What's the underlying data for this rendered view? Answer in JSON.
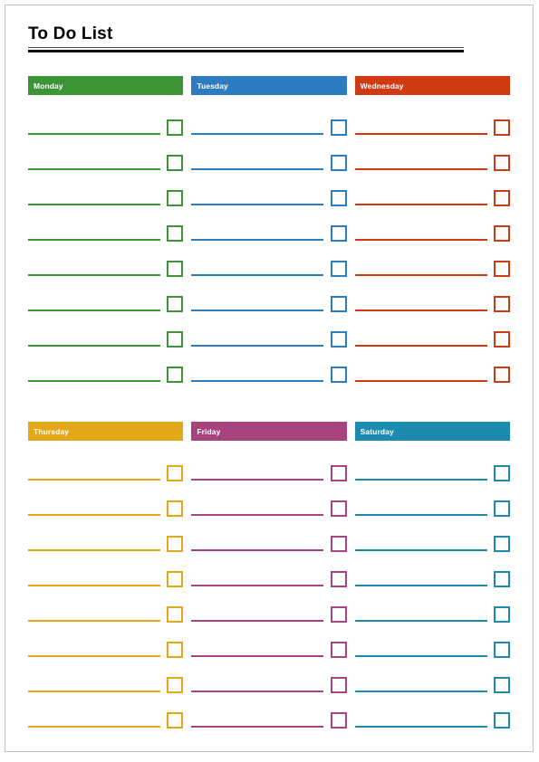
{
  "page": {
    "title": "To Do List",
    "border_color": "#bfbfbf",
    "background": "#ffffff"
  },
  "rows_per_day": 8,
  "days": [
    {
      "name": "Monday",
      "color": "#3D9435",
      "tasks": [
        "",
        "",
        "",
        "",
        "",
        "",
        "",
        ""
      ]
    },
    {
      "name": "Tuesday",
      "color": "#2E7CC0",
      "tasks": [
        "",
        "",
        "",
        "",
        "",
        "",
        "",
        ""
      ]
    },
    {
      "name": "Wednesday",
      "color": "#D03A12",
      "tasks": [
        "",
        "",
        "",
        "",
        "",
        "",
        "",
        ""
      ]
    },
    {
      "name": "Thursday",
      "color": "#E3A81A",
      "tasks": [
        "",
        "",
        "",
        "",
        "",
        "",
        "",
        ""
      ]
    },
    {
      "name": "Friday",
      "color": "#A9437D",
      "tasks": [
        "",
        "",
        "",
        "",
        "",
        "",
        "",
        ""
      ]
    },
    {
      "name": "Saturday",
      "color": "#1C8BAE",
      "tasks": [
        "",
        "",
        "",
        "",
        "",
        "",
        "",
        ""
      ]
    }
  ]
}
